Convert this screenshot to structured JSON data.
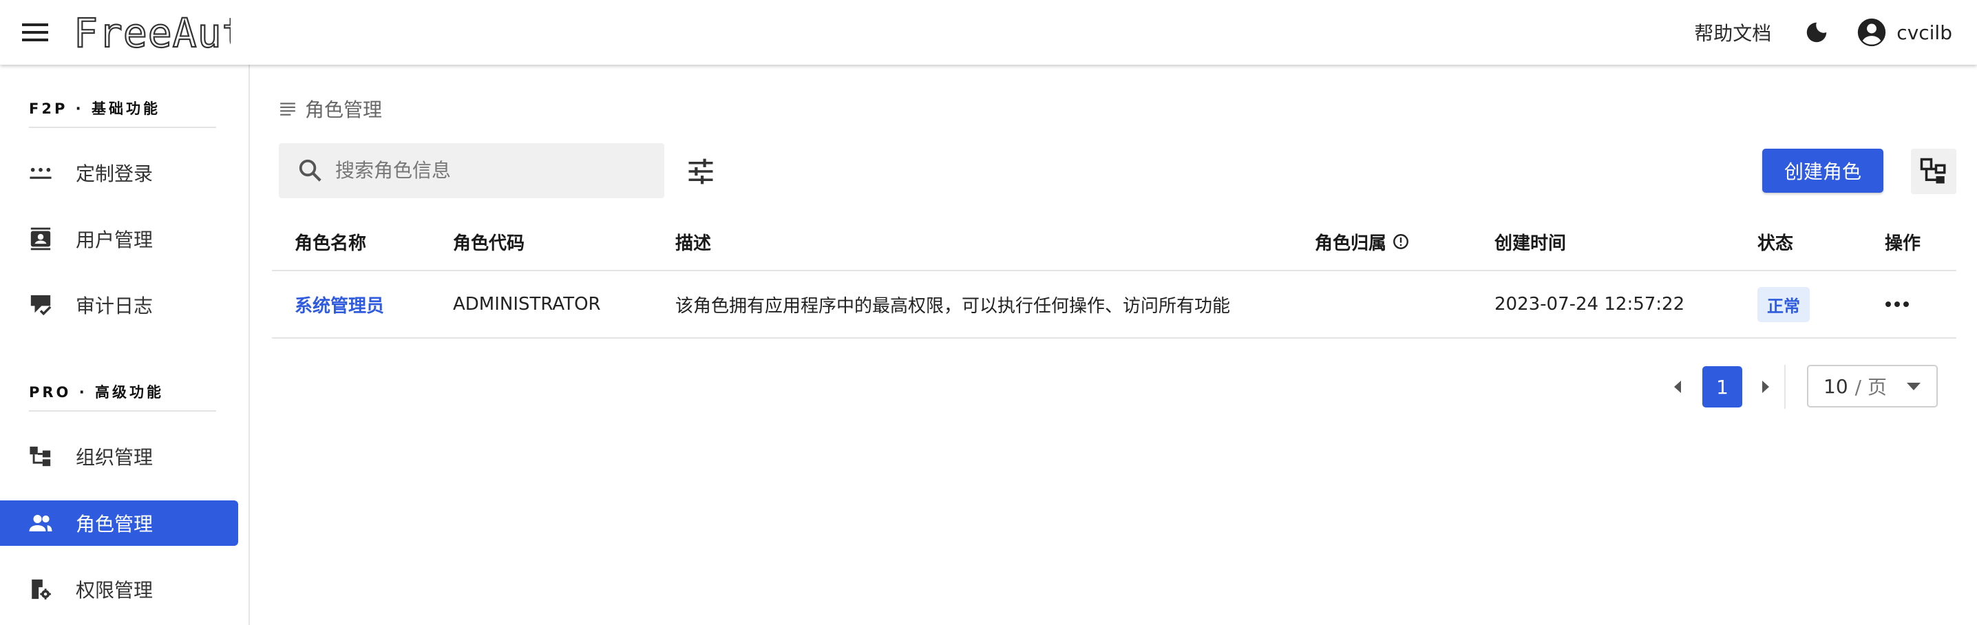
{
  "header": {
    "logo_text": "FreeAuth",
    "help_label": "帮助文档",
    "username": "cvcilb",
    "icons": {
      "menu": "menu-icon",
      "theme": "moon-icon",
      "account": "account-circle-icon"
    }
  },
  "sidebar": {
    "sections": [
      {
        "title": "F2P · 基础功能",
        "items": [
          {
            "label": "定制登录",
            "icon": "password-dots-icon",
            "active": false
          },
          {
            "label": "用户管理",
            "icon": "contact-book-icon",
            "active": false
          },
          {
            "label": "审计日志",
            "icon": "chat-check-icon",
            "active": false
          }
        ]
      },
      {
        "title": "PRO · 高级功能",
        "items": [
          {
            "label": "组织管理",
            "icon": "org-tree-icon",
            "active": false
          },
          {
            "label": "角色管理",
            "icon": "people-icon",
            "active": true
          },
          {
            "label": "权限管理",
            "icon": "lock-gear-icon",
            "active": false
          }
        ]
      }
    ]
  },
  "page": {
    "breadcrumb": "角色管理",
    "search_placeholder": "搜索角色信息",
    "create_button": "创建角色",
    "accent_color": "#2f5bde"
  },
  "table": {
    "columns": [
      "角色名称",
      "角色代码",
      "描述",
      "角色归属",
      "创建时间",
      "状态",
      "操作"
    ],
    "rows": [
      {
        "name": "系统管理员",
        "code": "ADMINISTRATOR",
        "description": "该角色拥有应用程序中的最高权限，可以执行任何操作、访问所有功能",
        "owner": "",
        "created_at": "2023-07-24 12:57:22",
        "status": "正常"
      }
    ]
  },
  "pagination": {
    "current_page": "1",
    "page_size": "10",
    "page_size_unit": "/ 页"
  }
}
